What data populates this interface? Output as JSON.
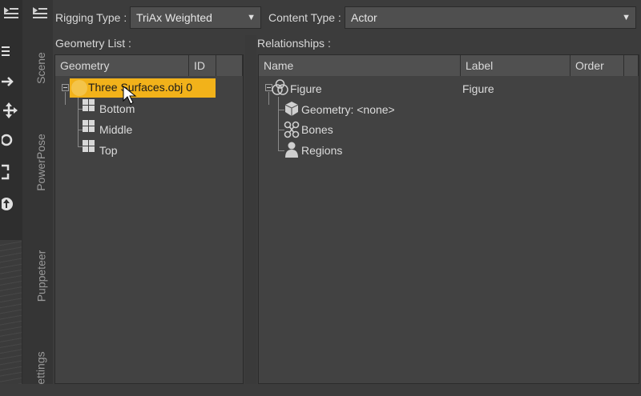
{
  "toolbar": {
    "rigging_type_label": "Rigging Type :",
    "rigging_type_value": "TriAx Weighted",
    "content_type_label": "Content Type :",
    "content_type_value": "Actor"
  },
  "tabs": [
    "Scene",
    "PowerPose",
    "Puppeteer",
    "ettings"
  ],
  "geometry_list": {
    "title": "Geometry List :",
    "columns": [
      "Geometry",
      "ID"
    ],
    "root": {
      "label": "Three Surfaces.obj",
      "id": "0"
    },
    "children": [
      "Bottom",
      "Middle",
      "Top"
    ]
  },
  "relationships": {
    "title": "Relationships :",
    "columns": [
      "Name",
      "Label",
      "Order"
    ],
    "root": {
      "name": "Figure",
      "label": "Figure"
    },
    "children": [
      "Geometry: <none>",
      "Bones",
      "Regions"
    ]
  },
  "colors": {
    "selection": "#f2b21a",
    "panel": "#424242",
    "background": "#3c3c3c"
  }
}
